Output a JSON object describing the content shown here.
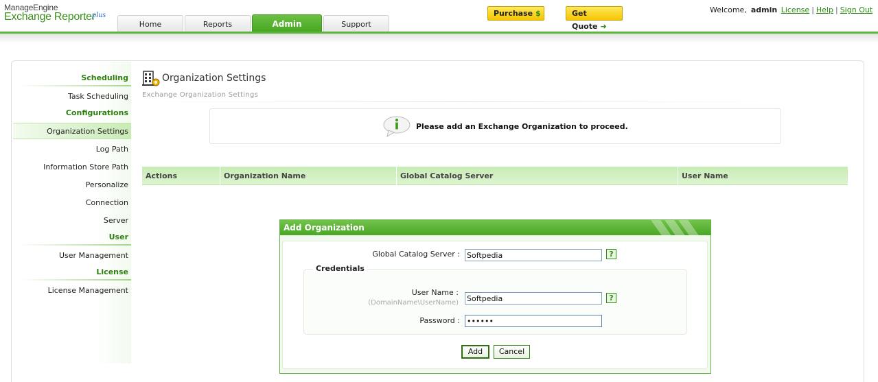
{
  "header": {
    "brand_line1": "ManageEngine",
    "brand_line2": "Exchange Reporter",
    "brand_plus": "plus",
    "tabs": [
      {
        "label": "Home",
        "active": false
      },
      {
        "label": "Reports",
        "active": false
      },
      {
        "label": "Admin",
        "active": true
      },
      {
        "label": "Support",
        "active": false
      }
    ],
    "purchase_label": "Purchase",
    "purchase_icon": "$",
    "quote_label": "Get Quote",
    "quote_icon": "➜",
    "welcome_text": "Welcome,",
    "username": "admin",
    "links": {
      "license": "License",
      "help": "Help",
      "signout": "Sign Out"
    },
    "link_sep": "|"
  },
  "sidebar": {
    "sections": [
      {
        "title": "Scheduling",
        "items": [
          "Task Scheduling"
        ]
      },
      {
        "title": "Configurations",
        "items": [
          "Organization Settings",
          "Log Path",
          "Information Store Path",
          "Personalize",
          "Connection",
          "Server"
        ]
      },
      {
        "title": "User",
        "items": [
          "User Management"
        ]
      },
      {
        "title": "License",
        "items": [
          "License Management"
        ]
      }
    ],
    "active_item": "Organization Settings"
  },
  "page": {
    "title": "Organization Settings",
    "subtitle": "Exchange Organization Settings",
    "info_message": "Please add an Exchange Organization to proceed."
  },
  "table": {
    "columns": [
      "Actions",
      "Organization Name",
      "Global Catalog Server",
      "User Name"
    ],
    "rows": []
  },
  "dialog": {
    "title": "Add Organization",
    "gc_label": "Global Catalog Server :",
    "gc_value": "Softpedia",
    "credentials_legend": "Credentials",
    "username_label": "User Name :",
    "username_hint": "(DomainName\\UserName)",
    "username_value": "Softpedia",
    "password_label": "Password :",
    "password_value": "••••••",
    "help_symbol": "?",
    "add_label": "Add",
    "cancel_label": "Cancel"
  },
  "colors": {
    "accent_green": "#4aa726",
    "link_green": "#2a8a12",
    "button_yellow": "#f5c400"
  }
}
